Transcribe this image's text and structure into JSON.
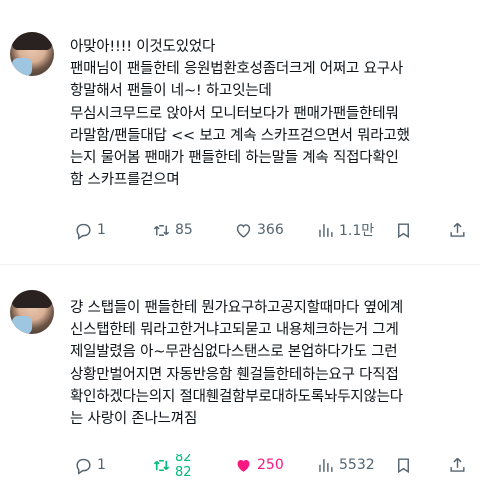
{
  "tweets": [
    {
      "lines": [
        "아맞아!!!! 이것도있었다",
        "팬매님이 팬들한테 응원법환호성좀더크게 어쩌고 요구사",
        "항말해서 팬들이 네~! 하고잇는데",
        "무심시크무드로 앉아서 모니터보다가 팬매가팬들한테뭐",
        "라말함/팬들대답 << 보고 계속 스카프걷으면서 뭐라고했",
        "는지 물어봄 팬매가 팬들한테 하는말들 계속 직접다확인",
        "함 스카프를걷으며"
      ],
      "reply_count": "1",
      "retweet_count": "85",
      "like_count": "366",
      "view_count": "1.1만"
    },
    {
      "lines": [
        "걍 스탭들이 팬들한테 뭔가요구하고공지할때마다 옆에계",
        "신스탭한테 뭐라고한거냐고되묻고 내용체크하는거 그게",
        "제일발렸음 아~무관심없다스탠스로 본업하다가도 그런",
        "상황만벌어지면 자동반응함 휀걸들한테하는요구 다직접",
        "확인하겠다는의지 절대휀걸함부로대하도록놔두지않는다",
        "는 사랑이 존나느껴짐"
      ],
      "reply_count": "1",
      "retweet_count_old": "82",
      "retweet_count_new": "82",
      "like_count": "250",
      "view_count": "5532"
    }
  ],
  "colors": {
    "text": "#0f1419",
    "muted": "#536471",
    "retweet": "#00ba7c",
    "like": "#f91880"
  }
}
